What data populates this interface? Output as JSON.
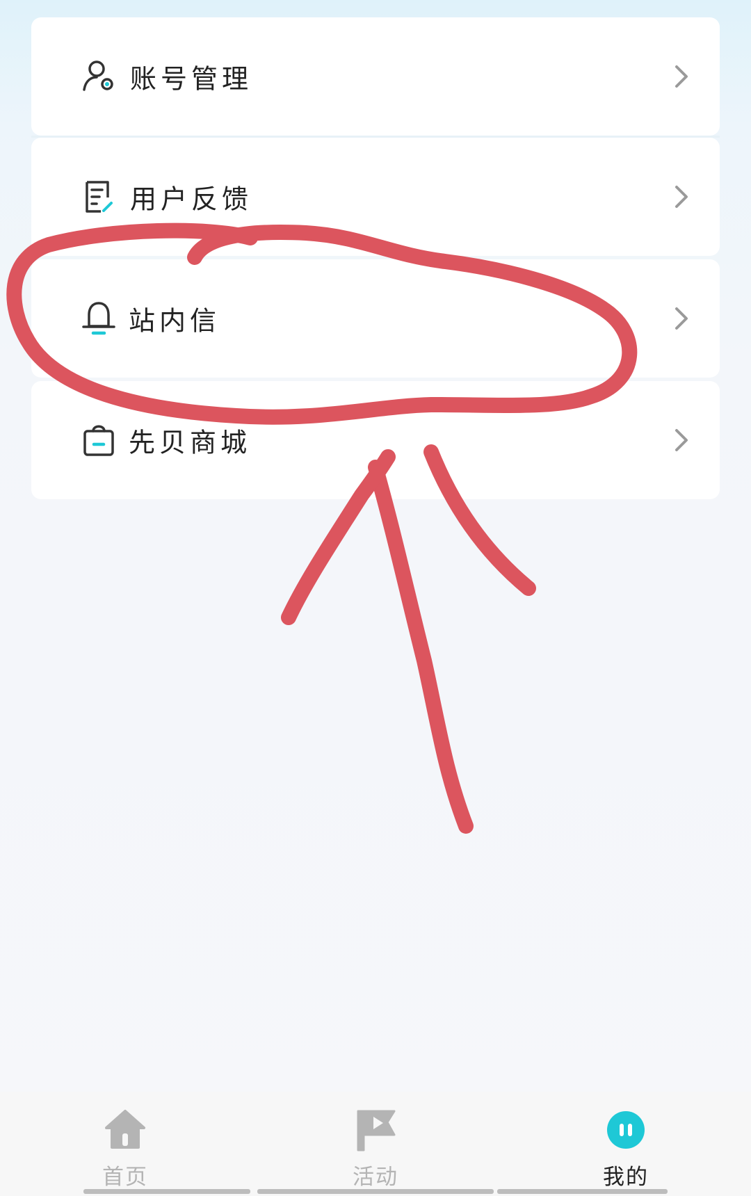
{
  "menu": {
    "items": [
      {
        "label": "账号管理",
        "icon": "user-settings-icon"
      },
      {
        "label": "用户反馈",
        "icon": "feedback-icon"
      },
      {
        "label": "站内信",
        "icon": "bell-icon"
      },
      {
        "label": "先贝商城",
        "icon": "shopping-bag-icon"
      }
    ],
    "chevron_icon": "chevron-right-icon"
  },
  "tabbar": {
    "tabs": [
      {
        "label": "首页",
        "icon": "home-icon",
        "active": false
      },
      {
        "label": "活动",
        "icon": "flag-icon",
        "active": false
      },
      {
        "label": "我的",
        "icon": "mascot-icon",
        "active": true
      }
    ]
  },
  "colors": {
    "accent": "#1ec8d6",
    "annotation": "#dc555e",
    "inactive_tab": "#b4b4b4",
    "active_tab_text": "#222222"
  },
  "annotation": {
    "description": "hand-drawn red circle around 站内信 with an arrow pointing to it"
  }
}
